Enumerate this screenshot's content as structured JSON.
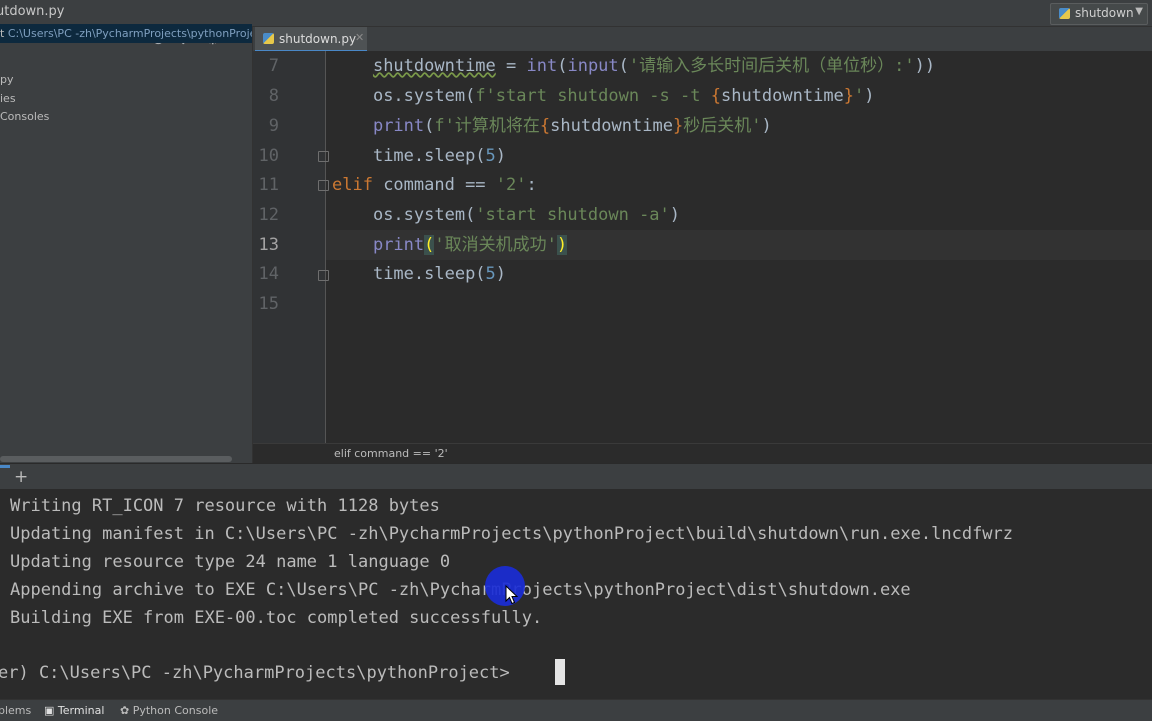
{
  "titlebar": {
    "file_title": "utdown.py",
    "run_config": "shutdown"
  },
  "project": {
    "root_prefix": "t",
    "root_path": "C:\\Users\\PC -zh\\PycharmProjects\\pythonProje",
    "items": [
      "py",
      "ies",
      "Consoles"
    ]
  },
  "editor": {
    "tab_label": "shutdown.py",
    "line_numbers": [
      "7",
      "8",
      "9",
      "10",
      "11",
      "12",
      "13",
      "14",
      "15"
    ],
    "current_line": "13",
    "breadcrumb": "elif command == '2'",
    "lines": {
      "l7": {
        "var": "shutdowntime",
        "eq": " = ",
        "int": "int",
        "p1": "(",
        "input": "input",
        "p2": "(",
        "s": "'请输入多长时间后关机（单位秒）:'",
        "p3": "))"
      },
      "l8": {
        "a": "os.system(",
        "s1": "f'start shutdown -s -t ",
        "b1": "{",
        "v": "shutdowntime",
        "b2": "}",
        "s2": "'",
        "c": ")"
      },
      "l9": {
        "print": "print",
        "p": "(",
        "s1": "f'计算机将在",
        "b1": "{",
        "v": "shutdowntime",
        "b2": "}",
        "s2": "秒后关机'",
        "c": ")"
      },
      "l10": {
        "a": "time.sleep(",
        "n": "5",
        "c": ")"
      },
      "l11": {
        "kw": "elif",
        "a": " command == ",
        "s": "'2'",
        "c": ":"
      },
      "l12": {
        "a": "os.system(",
        "s": "'start shutdown -a'",
        "c": ")"
      },
      "l13": {
        "print": "print",
        "p": "(",
        "s": "'取消关机成功'",
        "c": ")"
      },
      "l14": {
        "a": "time.sleep(",
        "n": "5",
        "c": ")"
      }
    }
  },
  "terminal": {
    "add_label": "+",
    "lines": [
      "Writing RT_ICON 7 resource with 1128 bytes",
      "Updating manifest in C:\\Users\\PC -zh\\PycharmProjects\\pythonProject\\build\\shutdown\\run.exe.lncdfwrz",
      "Updating resource type 24 name 1 language 0",
      "Appending archive to EXE C:\\Users\\PC -zh\\PycharmProjects\\pythonProject\\dist\\shutdown.exe",
      "Building EXE from EXE-00.toc completed successfully."
    ],
    "prompt": "er) C:\\Users\\PC -zh\\PycharmProjects\\pythonProject>"
  },
  "statusbar": {
    "problems": "blems",
    "terminal": "Terminal",
    "python_console": "Python Console"
  }
}
